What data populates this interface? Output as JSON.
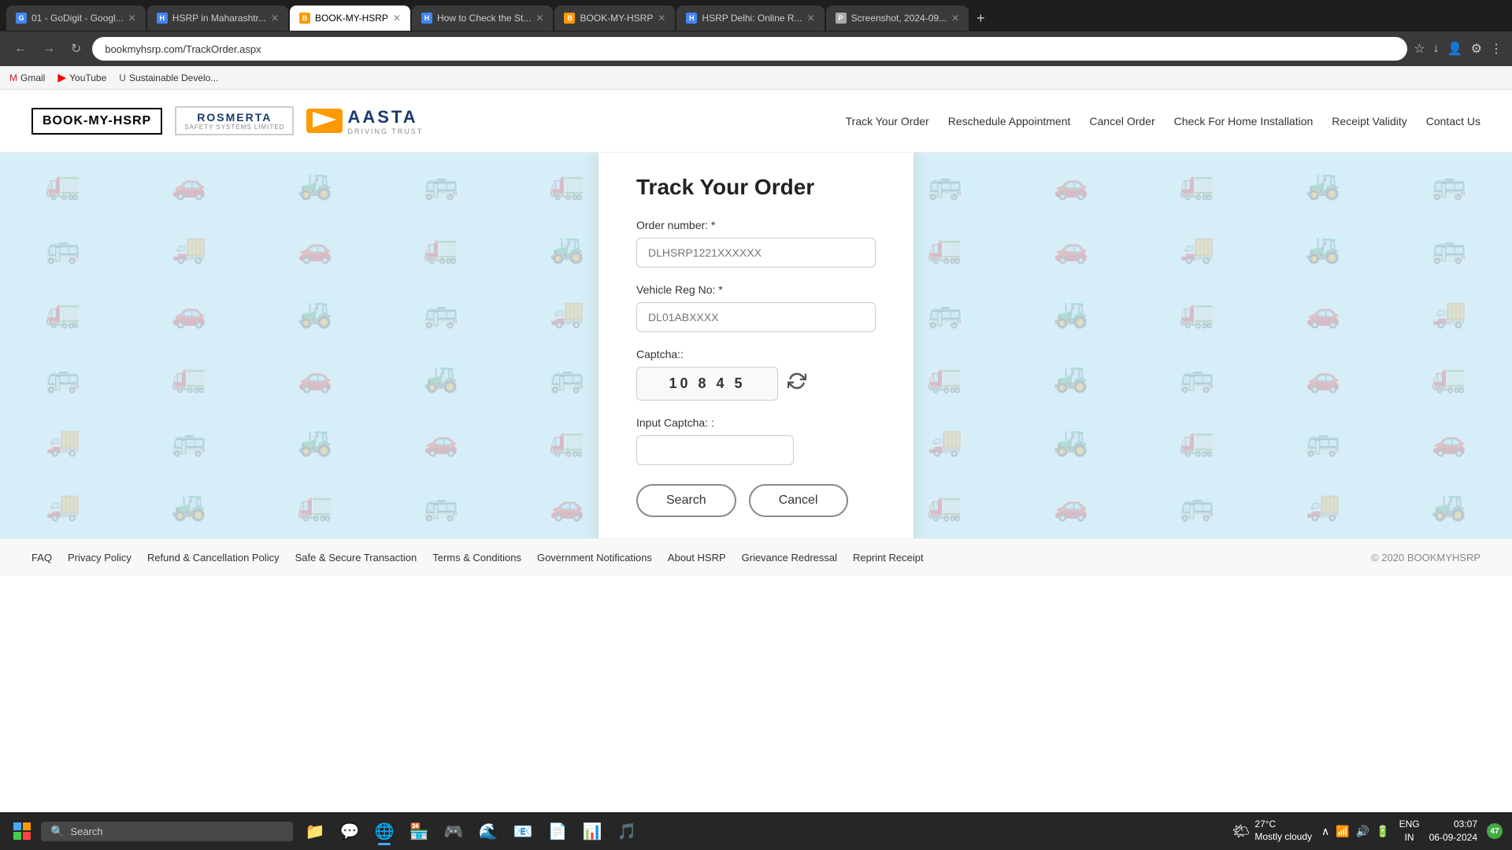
{
  "browser": {
    "tabs": [
      {
        "id": 1,
        "favicon_color": "#4285f4",
        "favicon_letter": "G",
        "title": "01 - GoDigit - Googl...",
        "active": false
      },
      {
        "id": 2,
        "favicon_color": "#4285f4",
        "favicon_letter": "H",
        "title": "HSRP in Maharashtr...",
        "active": false
      },
      {
        "id": 3,
        "favicon_color": "#f90",
        "favicon_letter": "B",
        "title": "BOOK-MY-HSRP",
        "active": true
      },
      {
        "id": 4,
        "favicon_color": "#4285f4",
        "favicon_letter": "H",
        "title": "How to Check the St...",
        "active": false
      },
      {
        "id": 5,
        "favicon_color": "#f90",
        "favicon_letter": "B",
        "title": "BOOK-MY-HSRP",
        "active": false
      },
      {
        "id": 6,
        "favicon_color": "#4285f4",
        "favicon_letter": "H",
        "title": "HSRP Delhi: Online R...",
        "active": false
      },
      {
        "id": 7,
        "favicon_color": "#aaa",
        "favicon_letter": "P",
        "title": "Screenshot, 2024-09...",
        "active": false
      }
    ],
    "url": "bookmyhsrp.com/TrackOrder.aspx",
    "bookmarks": [
      {
        "label": "Gmail"
      },
      {
        "label": "YouTube"
      },
      {
        "label": "Sustainable Develo..."
      }
    ]
  },
  "site": {
    "logos": {
      "book_my_hsrp": "BOOK-MY-HSRP",
      "rosmerta": "ROSMERTA",
      "rosmerta_sub": "SAFETY SYSTEMS LIMITED",
      "aasta": "AASTA",
      "aasta_sub": "DRIVING TRUST"
    },
    "nav": {
      "items": [
        {
          "label": "Track Your Order"
        },
        {
          "label": "Reschedule Appointment"
        },
        {
          "label": "Cancel Order"
        },
        {
          "label": "Check For Home Installation"
        },
        {
          "label": "Receipt Validity"
        },
        {
          "label": "Contact Us"
        }
      ]
    }
  },
  "track_form": {
    "title": "Track Your Order",
    "order_number_label": "Order number: *",
    "order_number_placeholder": "DLHSRP1221XXXXXX",
    "vehicle_reg_label": "Vehicle Reg No: *",
    "vehicle_reg_placeholder": "DL01ABXXXX",
    "captcha_label": "Captcha::",
    "captcha_value": "10 8  4 5",
    "input_captcha_label": "Input Captcha: :",
    "input_captcha_placeholder": "",
    "search_btn": "Search",
    "cancel_btn": "Cancel"
  },
  "footer": {
    "links": [
      {
        "label": "FAQ"
      },
      {
        "label": "Privacy Policy"
      },
      {
        "label": "Refund & Cancellation Policy"
      },
      {
        "label": "Safe & Secure Transaction"
      },
      {
        "label": "Terms & Conditions"
      },
      {
        "label": "Government Notifications"
      },
      {
        "label": "About HSRP"
      },
      {
        "label": "Grievance Redressal"
      },
      {
        "label": "Reprint Receipt"
      }
    ],
    "copyright": "© 2020 BOOKMYHSRP"
  },
  "taskbar": {
    "search_placeholder": "Search",
    "weather_temp": "27°C",
    "weather_desc": "Mostly cloudy",
    "language": "ENG\nIN",
    "time": "03:07",
    "date": "06-09-2024",
    "notification_count": "47"
  }
}
